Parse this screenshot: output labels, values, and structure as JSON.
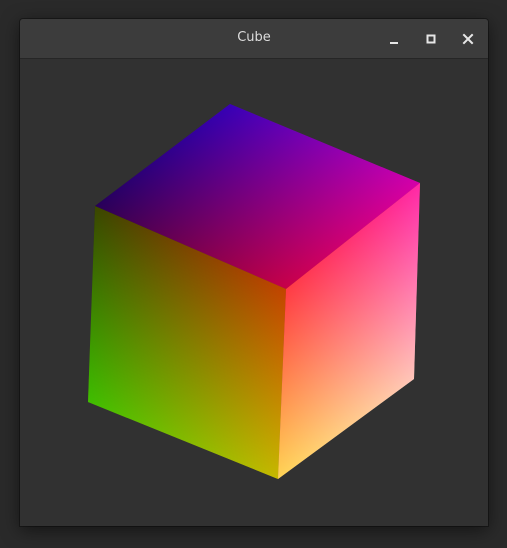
{
  "window": {
    "title": "Cube"
  },
  "controls": {
    "minimize_icon": "minimize-icon",
    "maximize_icon": "maximize-icon",
    "close_icon": "close-icon"
  },
  "colors": {
    "desktop": "#2a2a2a",
    "window_bg": "#313131",
    "titlebar_bg": "#3c3c3c",
    "title_text": "#dcdcdc",
    "cube_corner_black": "#000000",
    "cube_corner_blue": "#0000ff",
    "cube_corner_magenta": "#ff00ff",
    "cube_corner_red": "#ff0000",
    "cube_corner_green": "#00ff00",
    "cube_corner_yellow": "#ffff00",
    "cube_corner_white": "#ffffff"
  }
}
